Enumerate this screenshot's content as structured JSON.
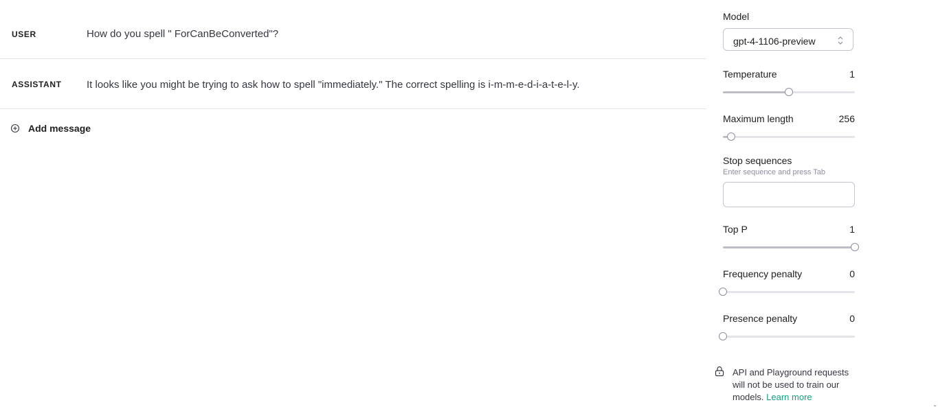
{
  "messages": [
    {
      "role": "USER",
      "content": "How do you spell \" ForCanBeConverted\"?"
    },
    {
      "role": "ASSISTANT",
      "content": "It looks like you might be trying to ask how to spell \"immediately.\" The correct spelling is i-m-m-e-d-i-a-t-e-l-y."
    }
  ],
  "add_message": {
    "label": "Add message",
    "icon": "plus-circle-icon"
  },
  "settings": {
    "model": {
      "label": "Model",
      "value": "gpt-4-1106-preview",
      "icon": "chevron-updown-icon"
    },
    "temperature": {
      "label": "Temperature",
      "value": "1",
      "fraction": 0.5
    },
    "maximum_length": {
      "label": "Maximum length",
      "value": "256",
      "fraction": 0.06
    },
    "stop_sequences": {
      "label": "Stop sequences",
      "hint": "Enter sequence and press Tab",
      "value": ""
    },
    "top_p": {
      "label": "Top P",
      "value": "1",
      "fraction": 1.0
    },
    "frequency_penalty": {
      "label": "Frequency penalty",
      "value": "0",
      "fraction": 0.0
    },
    "presence_penalty": {
      "label": "Presence penalty",
      "value": "0",
      "fraction": 0.0
    }
  },
  "notice": {
    "icon": "lock-icon",
    "text": "API and Playground requests will not be used to train our models.",
    "link": "Learn more"
  },
  "colors": {
    "accent": "#10a37f",
    "slider_track": "#e3e3e8",
    "slider_fill": "#bdbdc6",
    "border": "#c5c5d2"
  }
}
